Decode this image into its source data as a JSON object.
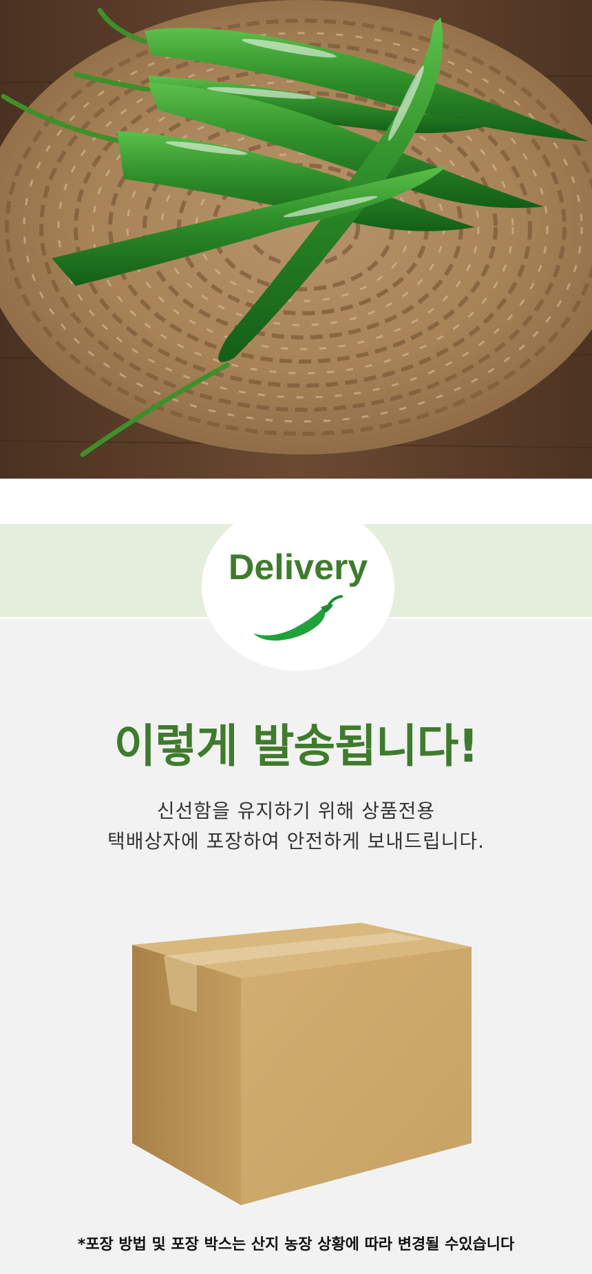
{
  "hero": {
    "icon": "green-chili-peppers-on-woven-mat-photo"
  },
  "delivery": {
    "badge_title": "Delivery",
    "badge_icon": "chili-pepper-icon",
    "headline": "이렇게 발송됩니다!",
    "desc_line1": "신선함을 유지하기 위해 상품전용",
    "desc_line2": "택배상자에 포장하여 안전하게 보내드립니다.",
    "box_icon": "cardboard-box-icon",
    "note": "*포장 방법 및 포장 박스는 산지 농장 상황에 따라 변경될 수있습니다"
  },
  "colors": {
    "accent": "#3f7b2d",
    "band": "#e5eedc",
    "pepper": "#1fa23a",
    "box": "#c9a56a"
  }
}
